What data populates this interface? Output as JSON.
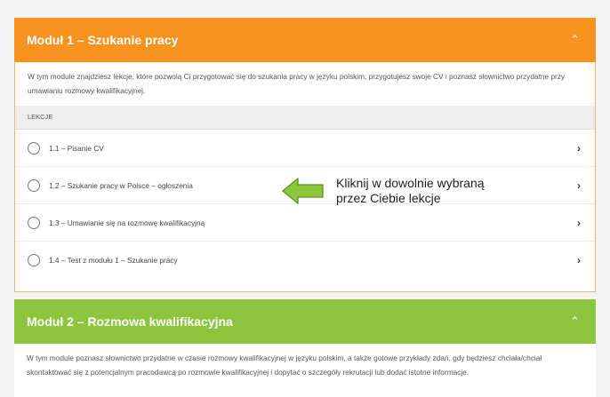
{
  "modules": [
    {
      "title": "Moduł 1 – Szukanie pracy",
      "color": "#f7931e",
      "expanded": true,
      "description": "W tym module znajdziesz lekcje, które pozwolą Ci przygotować się do szukania pracy w języku polskim, przygotujesz swoje CV i poznasz słownictwo przydatne przy umawianiu rozmowy kwalifikacyjnej.",
      "lessons_label": "LEKCJE",
      "lessons": [
        {
          "label": "1.1 – Pisanie CV"
        },
        {
          "label": "1.2 – Szukanie pracy w Polsce – ogłoszenia"
        },
        {
          "label": "1.3 – Umawianie się na rozmowę kwalifikacyjną"
        },
        {
          "label": "1.4 – Test z modułu 1 – Szukanie pracy"
        }
      ]
    },
    {
      "title": "Moduł 2 – Rozmowa kwalifikacyjna",
      "color": "#8cc63f",
      "expanded": true,
      "description": "W tym module poznasz słownictwo przydatne w czasie rozmowy kwalifikacyjnej w języku polskim, a także gotowe przykłady zdań, gdy będziesz chciała/chciał skontaktować się z potencjalnym pracodawcą po rozmowie kwalifikacyjnej i dopytać o szczegóły rekrutacji lub dodać istotne informacje."
    }
  ],
  "hint": {
    "line1": "Kliknij w dowolnie wybraną",
    "line2": "przez Ciebie lekcje",
    "arrow_color": "#8cc63f"
  }
}
